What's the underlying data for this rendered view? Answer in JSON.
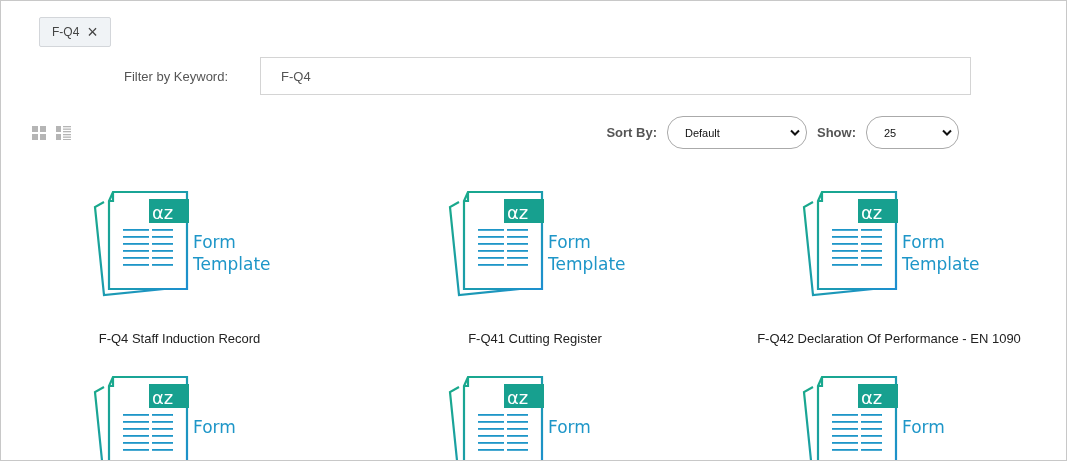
{
  "active_filters": [
    {
      "label": "F-Q4",
      "remove": "×"
    }
  ],
  "keyword_filter": {
    "label": "Filter by Keyword:",
    "value": "F-Q4"
  },
  "sort": {
    "label": "Sort By:",
    "value": "Default"
  },
  "show": {
    "label": "Show:",
    "value": "25"
  },
  "items": [
    {
      "thumbnail": {
        "badge": "αz",
        "caption_lines": [
          "Form",
          "Template"
        ]
      },
      "title": "F-Q4 Staff Induction Record"
    },
    {
      "thumbnail": {
        "badge": "αz",
        "caption_lines": [
          "Form",
          "Template"
        ]
      },
      "title": "F-Q41 Cutting Register"
    },
    {
      "thumbnail": {
        "badge": "αz",
        "caption_lines": [
          "Form",
          "Template"
        ]
      },
      "title": "F-Q42 Declaration Of Performance - EN 1090"
    },
    {
      "thumbnail": {
        "badge": "αz",
        "caption_lines": [
          "Form"
        ]
      }
    },
    {
      "thumbnail": {
        "badge": "αz",
        "caption_lines": [
          "Form"
        ]
      }
    },
    {
      "thumbnail": {
        "badge": "αz",
        "caption_lines": [
          "Form"
        ]
      }
    }
  ]
}
